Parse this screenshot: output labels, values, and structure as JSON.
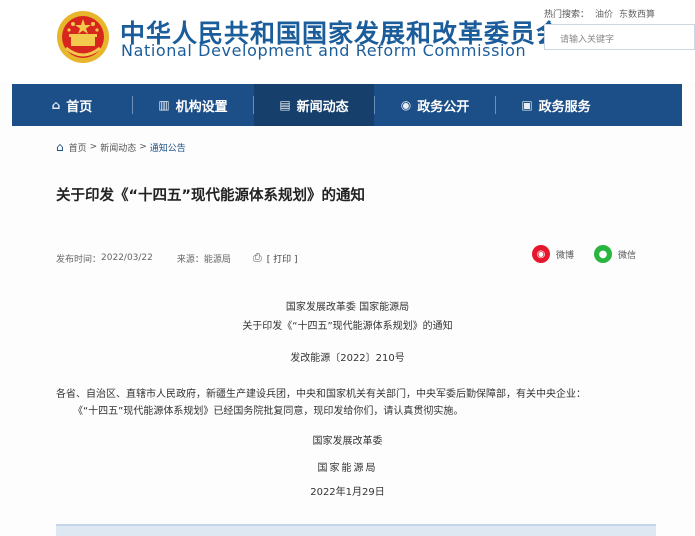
{
  "header": {
    "title_cn": "中华人民共和国国家发展和改革委员会",
    "title_en": "National Development and Reform Commission",
    "hot_search_label": "热门搜索：",
    "hot_terms": [
      "油价",
      "东数西算"
    ],
    "search_placeholder": "请输入关键字",
    "emblem_icon": "national-emblem-icon"
  },
  "nav": {
    "items": [
      {
        "label": "首页",
        "icon": "home-icon"
      },
      {
        "label": "机构设置",
        "icon": "building-icon"
      },
      {
        "label": "新闻动态",
        "icon": "newspaper-icon"
      },
      {
        "label": "政务公开",
        "icon": "broadcast-icon"
      },
      {
        "label": "政务服务",
        "icon": "document-icon"
      }
    ],
    "active_index": 2
  },
  "breadcrumb": {
    "items": [
      "首页",
      "新闻动态",
      "通知公告"
    ],
    "separator": ">"
  },
  "article": {
    "title": "关于印发《“十四五”现代能源体系规划》的通知",
    "publish_label": "发布时间：",
    "publish_date": "2022/03/22",
    "source_label": "来源：",
    "source": "能源局",
    "print_label": "[ 打印 ]",
    "share_weibo": "微博",
    "share_wechat": "微信",
    "issuers": "国家发展改革委 国家能源局",
    "subject": "关于印发《“十四五”现代能源体系规划》的通知",
    "doc_number": "发改能源〔2022〕210号",
    "recipients": "各省、自治区、直辖市人民政府，新疆生产建设兵团，中央和国家机关有关部门，中央军委后勤保障部，有关中央企业：",
    "body": "《“十四五”现代能源体系规划》已经国务院批复同意，现印发给你们，请认真贯彻实施。",
    "sign_1": "国家发展改革委",
    "sign_2": "国家能源局",
    "sign_date": "2022年1月29日"
  },
  "colors": {
    "brand_blue": "#1b5d9b",
    "nav_bg": "#1c4f87",
    "weibo_red": "#e6162d",
    "wechat_green": "#29b53f"
  }
}
